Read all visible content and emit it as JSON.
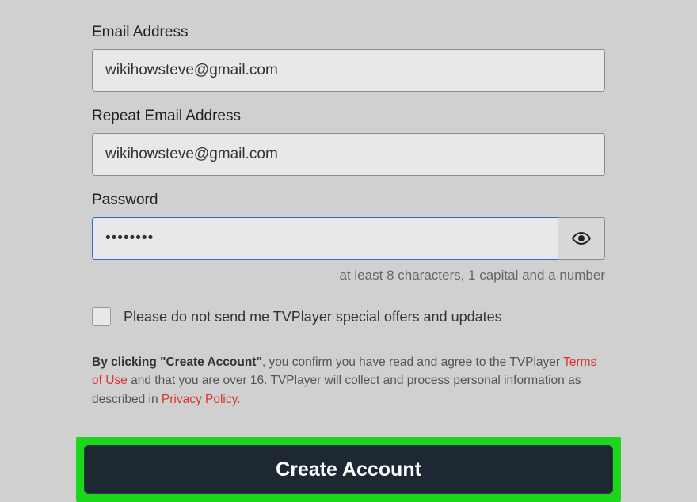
{
  "email": {
    "label": "Email Address",
    "value": "wikihowsteve@gmail.com"
  },
  "repeat_email": {
    "label": "Repeat Email Address",
    "value": "wikihowsteve@gmail.com"
  },
  "password": {
    "label": "Password",
    "value": "••••••••",
    "hint": "at least 8 characters, 1 capital and a number"
  },
  "checkbox": {
    "label": "Please do not send me TVPlayer special offers and updates"
  },
  "terms": {
    "part1_bold": "By clicking \"Create Account\"",
    "part2": ", you confirm you have read and agree to the TVPlayer ",
    "link1": "Terms of Use",
    "part3": " and that you are over 16. TVPlayer will collect and process personal information as described in ",
    "link2": "Privacy Policy",
    "part4": "."
  },
  "button": {
    "label": "Create Account"
  }
}
